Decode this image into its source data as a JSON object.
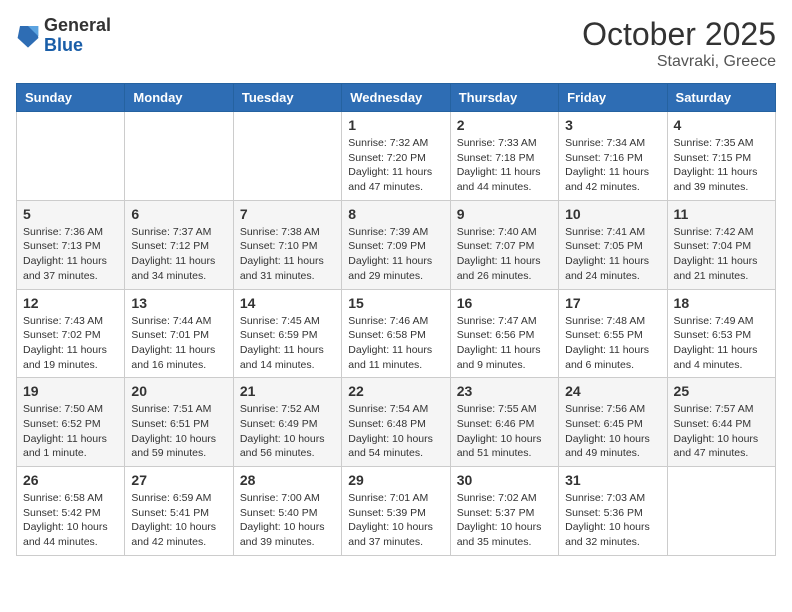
{
  "header": {
    "logo": {
      "general": "General",
      "blue": "Blue"
    },
    "month": "October 2025",
    "location": "Stavraki, Greece"
  },
  "weekdays": [
    "Sunday",
    "Monday",
    "Tuesday",
    "Wednesday",
    "Thursday",
    "Friday",
    "Saturday"
  ],
  "weeks": [
    [
      {
        "day": "",
        "info": ""
      },
      {
        "day": "",
        "info": ""
      },
      {
        "day": "",
        "info": ""
      },
      {
        "day": "1",
        "info": "Sunrise: 7:32 AM\nSunset: 7:20 PM\nDaylight: 11 hours and 47 minutes."
      },
      {
        "day": "2",
        "info": "Sunrise: 7:33 AM\nSunset: 7:18 PM\nDaylight: 11 hours and 44 minutes."
      },
      {
        "day": "3",
        "info": "Sunrise: 7:34 AM\nSunset: 7:16 PM\nDaylight: 11 hours and 42 minutes."
      },
      {
        "day": "4",
        "info": "Sunrise: 7:35 AM\nSunset: 7:15 PM\nDaylight: 11 hours and 39 minutes."
      }
    ],
    [
      {
        "day": "5",
        "info": "Sunrise: 7:36 AM\nSunset: 7:13 PM\nDaylight: 11 hours and 37 minutes."
      },
      {
        "day": "6",
        "info": "Sunrise: 7:37 AM\nSunset: 7:12 PM\nDaylight: 11 hours and 34 minutes."
      },
      {
        "day": "7",
        "info": "Sunrise: 7:38 AM\nSunset: 7:10 PM\nDaylight: 11 hours and 31 minutes."
      },
      {
        "day": "8",
        "info": "Sunrise: 7:39 AM\nSunset: 7:09 PM\nDaylight: 11 hours and 29 minutes."
      },
      {
        "day": "9",
        "info": "Sunrise: 7:40 AM\nSunset: 7:07 PM\nDaylight: 11 hours and 26 minutes."
      },
      {
        "day": "10",
        "info": "Sunrise: 7:41 AM\nSunset: 7:05 PM\nDaylight: 11 hours and 24 minutes."
      },
      {
        "day": "11",
        "info": "Sunrise: 7:42 AM\nSunset: 7:04 PM\nDaylight: 11 hours and 21 minutes."
      }
    ],
    [
      {
        "day": "12",
        "info": "Sunrise: 7:43 AM\nSunset: 7:02 PM\nDaylight: 11 hours and 19 minutes."
      },
      {
        "day": "13",
        "info": "Sunrise: 7:44 AM\nSunset: 7:01 PM\nDaylight: 11 hours and 16 minutes."
      },
      {
        "day": "14",
        "info": "Sunrise: 7:45 AM\nSunset: 6:59 PM\nDaylight: 11 hours and 14 minutes."
      },
      {
        "day": "15",
        "info": "Sunrise: 7:46 AM\nSunset: 6:58 PM\nDaylight: 11 hours and 11 minutes."
      },
      {
        "day": "16",
        "info": "Sunrise: 7:47 AM\nSunset: 6:56 PM\nDaylight: 11 hours and 9 minutes."
      },
      {
        "day": "17",
        "info": "Sunrise: 7:48 AM\nSunset: 6:55 PM\nDaylight: 11 hours and 6 minutes."
      },
      {
        "day": "18",
        "info": "Sunrise: 7:49 AM\nSunset: 6:53 PM\nDaylight: 11 hours and 4 minutes."
      }
    ],
    [
      {
        "day": "19",
        "info": "Sunrise: 7:50 AM\nSunset: 6:52 PM\nDaylight: 11 hours and 1 minute."
      },
      {
        "day": "20",
        "info": "Sunrise: 7:51 AM\nSunset: 6:51 PM\nDaylight: 10 hours and 59 minutes."
      },
      {
        "day": "21",
        "info": "Sunrise: 7:52 AM\nSunset: 6:49 PM\nDaylight: 10 hours and 56 minutes."
      },
      {
        "day": "22",
        "info": "Sunrise: 7:54 AM\nSunset: 6:48 PM\nDaylight: 10 hours and 54 minutes."
      },
      {
        "day": "23",
        "info": "Sunrise: 7:55 AM\nSunset: 6:46 PM\nDaylight: 10 hours and 51 minutes."
      },
      {
        "day": "24",
        "info": "Sunrise: 7:56 AM\nSunset: 6:45 PM\nDaylight: 10 hours and 49 minutes."
      },
      {
        "day": "25",
        "info": "Sunrise: 7:57 AM\nSunset: 6:44 PM\nDaylight: 10 hours and 47 minutes."
      }
    ],
    [
      {
        "day": "26",
        "info": "Sunrise: 6:58 AM\nSunset: 5:42 PM\nDaylight: 10 hours and 44 minutes."
      },
      {
        "day": "27",
        "info": "Sunrise: 6:59 AM\nSunset: 5:41 PM\nDaylight: 10 hours and 42 minutes."
      },
      {
        "day": "28",
        "info": "Sunrise: 7:00 AM\nSunset: 5:40 PM\nDaylight: 10 hours and 39 minutes."
      },
      {
        "day": "29",
        "info": "Sunrise: 7:01 AM\nSunset: 5:39 PM\nDaylight: 10 hours and 37 minutes."
      },
      {
        "day": "30",
        "info": "Sunrise: 7:02 AM\nSunset: 5:37 PM\nDaylight: 10 hours and 35 minutes."
      },
      {
        "day": "31",
        "info": "Sunrise: 7:03 AM\nSunset: 5:36 PM\nDaylight: 10 hours and 32 minutes."
      },
      {
        "day": "",
        "info": ""
      }
    ]
  ]
}
